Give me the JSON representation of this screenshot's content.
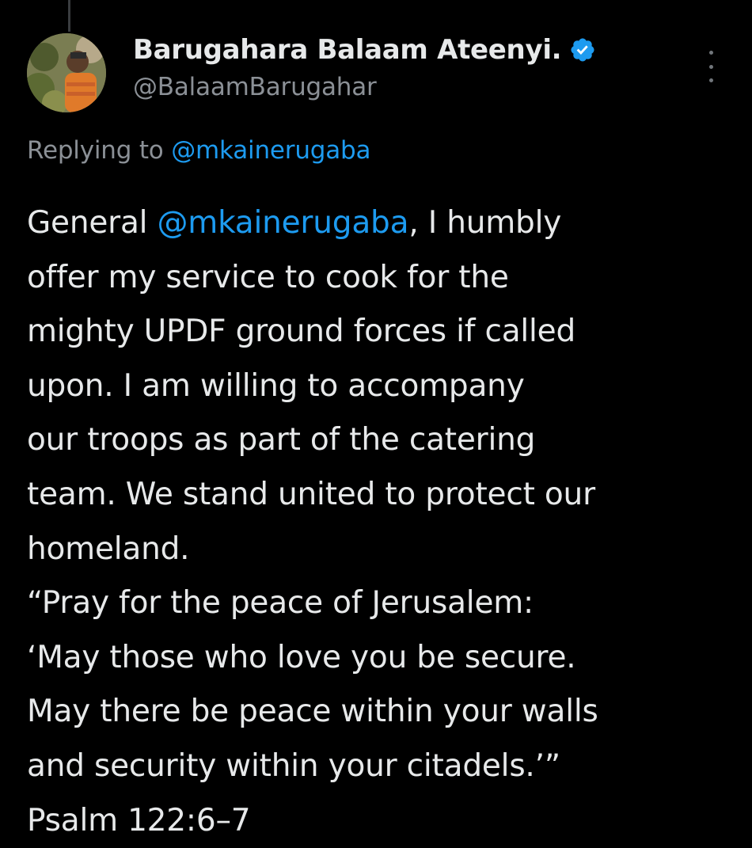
{
  "tweet": {
    "author": {
      "display_name": "Barugahara Balaam Ateenyi.",
      "handle": "@BalaamBarugahar",
      "verified": true,
      "verified_color": "#1d9bf0"
    },
    "replying_to": {
      "prefix": "Replying to ",
      "handle": "@mkainerugaba"
    },
    "body": {
      "line1_prefix": "General ",
      "line1_mention": "@mkainerugaba",
      "line1_suffix": ", I humbly",
      "lines": [
        "offer my service to cook for the",
        "mighty UPDF ground forces if called",
        "upon. I am willing to accompany",
        "our troops as part of the catering",
        "team. We stand united to protect our",
        "homeland.",
        "“Pray for the peace of Jerusalem:",
        "‘May those who love you be secure.",
        "May there be peace within your walls",
        "and security within your citadels.’”",
        "Psalm 122:6–7"
      ]
    }
  },
  "icons": {
    "verified": "verified-badge-icon",
    "more": "more-options-icon"
  },
  "colors": {
    "background": "#000000",
    "text": "#e7e9ea",
    "secondary": "#8b9096",
    "link": "#1d9bf0"
  }
}
